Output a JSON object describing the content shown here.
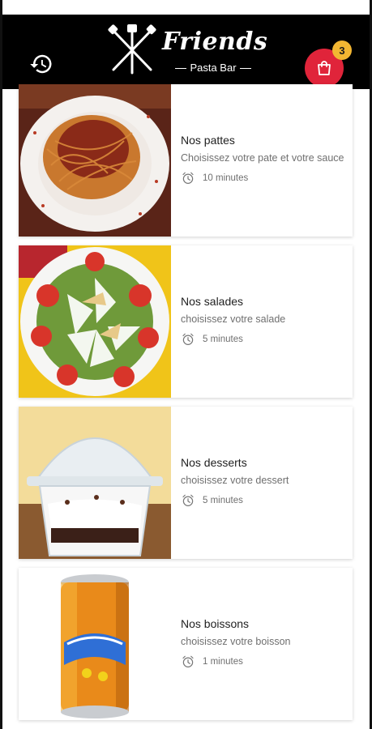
{
  "header": {
    "logo_title": "Friends",
    "logo_subtitle": "Pasta Bar",
    "cart_count": "3",
    "history_icon": "history-clock-icon",
    "cart_icon": "shopping-bag-icon",
    "colors": {
      "header_bg": "#000000",
      "cart_bg": "#e0243a",
      "badge_bg": "#f2b632"
    }
  },
  "categories": [
    {
      "title": "Nos pattes",
      "description": "Choisissez votre pate et votre sauce",
      "time": "10 minutes",
      "image": "spaghetti-bolognese"
    },
    {
      "title": "Nos salades",
      "description": "choisissez votre salade",
      "time": "5 minutes",
      "image": "salad-plate"
    },
    {
      "title": "Nos desserts",
      "description": "choisissez votre dessert",
      "time": "5 minutes",
      "image": "dessert-cup"
    },
    {
      "title": "Nos boissons",
      "description": "choisissez votre boisson",
      "time": "1 minutes",
      "image": "soda-can"
    }
  ]
}
